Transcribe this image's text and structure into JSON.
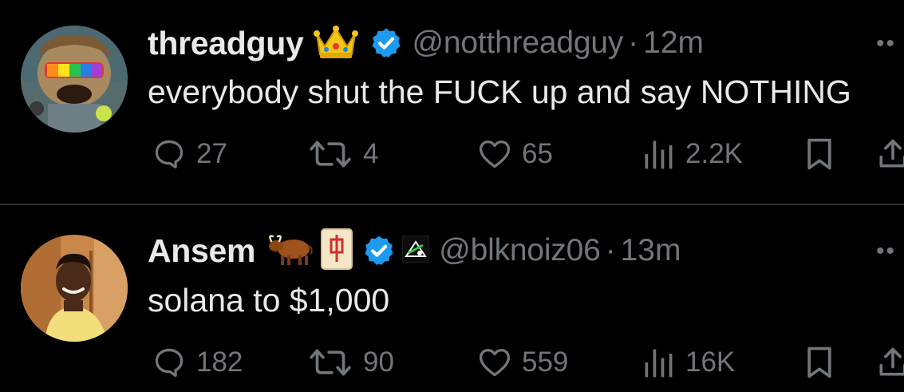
{
  "tweets": [
    {
      "author_name": "threadguy",
      "badge_icon": "crown-emoji",
      "verified_icon": "verified-badge-icon",
      "handle": "@notthreadguy",
      "separator": "·",
      "time": "12m",
      "text": "everybody shut the FUCK up and say NOTHING",
      "reply_count": "27",
      "repost_count": "4",
      "like_count": "65",
      "view_count": "2.2K"
    },
    {
      "author_name": "Ansem",
      "badge_icons": [
        "ox-emoji",
        "mahjong-red-dragon-emoji",
        "verified-badge-icon",
        "affiliate-badge-icon"
      ],
      "handle": "@blknoiz06",
      "separator": "·",
      "time": "13m",
      "text": "solana to $1,000",
      "reply_count": "182",
      "repost_count": "90",
      "like_count": "559",
      "view_count": "16K"
    }
  ],
  "colors": {
    "background": "#000000",
    "primary_text": "#e7e9ea",
    "secondary_text": "#71767b",
    "verified_blue": "#1d9bf0",
    "divider": "#2f3336"
  }
}
